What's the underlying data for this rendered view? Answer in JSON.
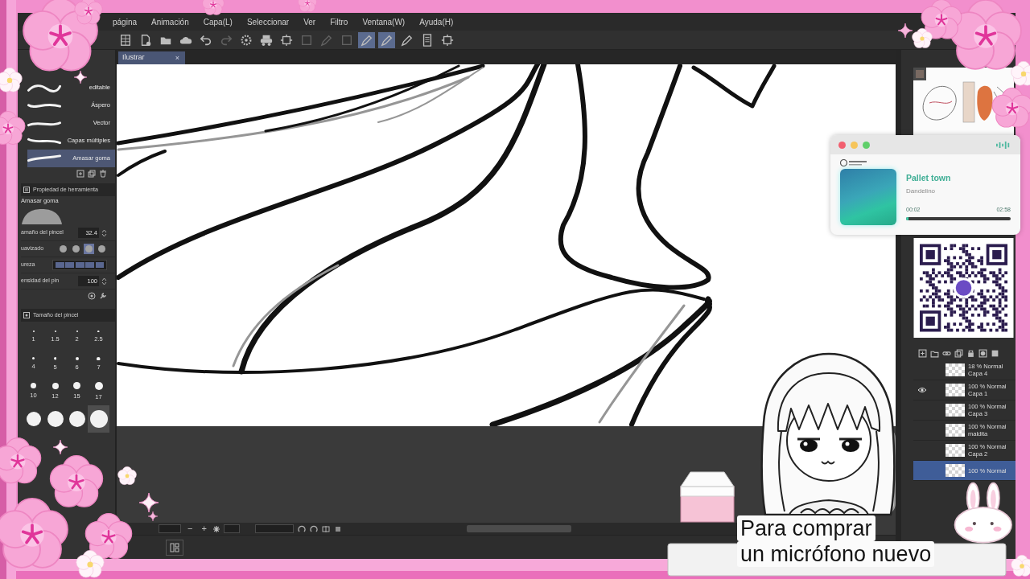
{
  "menu": [
    "página",
    "Animación",
    "Capa(L)",
    "Seleccionar",
    "Ver",
    "Filtro",
    "Ventana(W)",
    "Ayuda(H)"
  ],
  "toolbar": [
    {
      "kind": "page-grid",
      "selected": false,
      "disabled": false
    },
    {
      "kind": "new-page",
      "selected": false,
      "disabled": false
    },
    {
      "kind": "folder",
      "selected": false,
      "disabled": false
    },
    {
      "kind": "cloud",
      "selected": false,
      "disabled": false
    },
    {
      "kind": "undo",
      "selected": false,
      "disabled": false
    },
    {
      "kind": "redo",
      "selected": false,
      "disabled": true
    },
    {
      "kind": "gear",
      "selected": false,
      "disabled": false
    },
    {
      "kind": "printer",
      "selected": false,
      "disabled": false
    },
    {
      "kind": "frame",
      "selected": false,
      "disabled": false
    },
    {
      "kind": "square",
      "selected": false,
      "disabled": true
    },
    {
      "kind": "pen",
      "selected": false,
      "disabled": true
    },
    {
      "kind": "square",
      "selected": false,
      "disabled": true
    },
    {
      "kind": "pen",
      "selected": true,
      "disabled": false
    },
    {
      "kind": "pen",
      "selected": true,
      "disabled": false
    },
    {
      "kind": "pen",
      "selected": false,
      "disabled": false
    },
    {
      "kind": "document",
      "selected": false,
      "disabled": false
    },
    {
      "kind": "frame",
      "selected": false,
      "disabled": false
    }
  ],
  "canvas_tab": {
    "label": "Ilustrar",
    "close": "×",
    "selected": true
  },
  "subtools": [
    {
      "label": "editable",
      "selected": false
    },
    {
      "label": "Áspero",
      "selected": false
    },
    {
      "label": "Vector",
      "selected": false
    },
    {
      "label": "Capas múltiples",
      "selected": false
    },
    {
      "label": "Amasar goma",
      "selected": true
    }
  ],
  "tool_property": {
    "title": "Propiedad de herramienta",
    "tool_name": "Amasar goma",
    "rows": [
      {
        "kind": "number",
        "label": "amaño del pincel",
        "value": "32.4"
      },
      {
        "kind": "options",
        "label": "uavizado",
        "options": [
          {
            "selected": false
          },
          {
            "selected": false
          },
          {
            "selected": true
          },
          {
            "selected": false
          }
        ]
      },
      {
        "kind": "bar",
        "label": "ureza",
        "level": 1
      },
      {
        "kind": "number",
        "label": "ensidad del pin",
        "value": "100"
      }
    ]
  },
  "brush_sizes": {
    "title": "Tamaño del pincel",
    "items": [
      {
        "label": "1",
        "selected": false
      },
      {
        "label": "1.5",
        "selected": false
      },
      {
        "label": "2",
        "selected": false
      },
      {
        "label": "2.5",
        "selected": false
      },
      {
        "label": "4",
        "selected": false
      },
      {
        "label": "5",
        "selected": false
      },
      {
        "label": "6",
        "selected": false
      },
      {
        "label": "7",
        "selected": false
      },
      {
        "label": "10",
        "selected": false
      },
      {
        "label": "12",
        "selected": false
      },
      {
        "label": "15",
        "selected": false
      },
      {
        "label": "17",
        "selected": false
      },
      {
        "selected": false
      },
      {
        "selected": false
      },
      {
        "selected": false
      },
      {
        "selected": true
      }
    ]
  },
  "navigator_bar": {
    "zoom_out": "−",
    "zoom_in": "+"
  },
  "music_player": {
    "title": "Pallet town",
    "artist": "Dandelino",
    "elapsed": "00:02",
    "duration": "02:58",
    "level": 0.02
  },
  "layers": [
    {
      "mode": "18 % Normal",
      "name": "Capa 4",
      "visible": false,
      "selected": false
    },
    {
      "mode": "100 % Normal",
      "name": "Capa 1",
      "visible": true,
      "selected": false
    },
    {
      "mode": "100 % Normal",
      "name": "Capa 3",
      "visible": false,
      "selected": false
    },
    {
      "mode": "100 % Normal",
      "name": "maldita",
      "visible": false,
      "selected": false
    },
    {
      "mode": "100 % Normal",
      "name": "Capa 2",
      "visible": false,
      "selected": false
    },
    {
      "mode": "100 % Normal",
      "visible": false,
      "selected": true
    }
  ],
  "caption": [
    "Para comprar",
    "un micrófono nuevo"
  ]
}
